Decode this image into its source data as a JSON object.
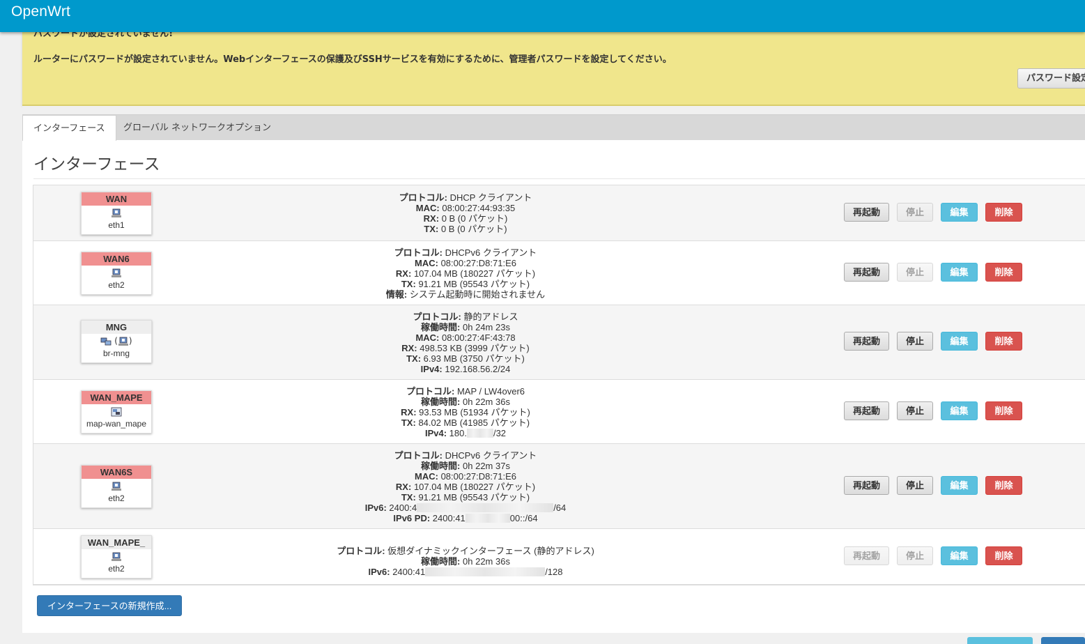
{
  "app": {
    "brand": "OpenWrt"
  },
  "alert": {
    "title": "パスワードが設定されていません!",
    "message": "ルーターにパスワードが設定されていません。Webインターフェースの保護及びSSHサービスを有効にするために、管理者パスワードを設定してください。",
    "button": "パスワード設定"
  },
  "tabs": [
    {
      "label": "インターフェース",
      "active": true
    },
    {
      "label": "グローバル ネットワークオプション",
      "active": false
    }
  ],
  "page_title": "インターフェース",
  "labels": {
    "protocol": "プロトコル:",
    "uptime": "稼働時間:",
    "mac": "MAC:",
    "rx": "RX:",
    "tx": "TX:",
    "info": "情報:",
    "ipv4": "IPv4:",
    "ipv6": "IPv6:",
    "ipv6pd": "IPv6 PD:"
  },
  "buttons": {
    "restart": "再起動",
    "stop": "停止",
    "edit": "編集",
    "delete": "削除",
    "add": "インターフェースの新規作成..."
  },
  "interfaces": [
    {
      "name": "WAN",
      "device": "eth1",
      "color": "#f09090",
      "protocol": "DHCP クライアント",
      "mac": "08:00:27:44:93:35",
      "rx": "0 B (0 パケット)",
      "tx": "0 B (0 パケット)"
    },
    {
      "name": "WAN6",
      "device": "eth2",
      "color": "#f09090",
      "protocol": "DHCPv6 クライアント",
      "mac": "08:00:27:D8:71:E6",
      "rx": "107.04 MB (180227 パケット)",
      "tx": "91.21 MB (95543 パケット)",
      "info": "システム起動時に開始されません"
    },
    {
      "name": "MNG",
      "device": "br-mng",
      "color": "#eeeeee",
      "protocol": "静的アドレス",
      "uptime": "0h 24m 23s",
      "mac": "08:00:27:4F:43:78",
      "rx": "498.53 KB (3999 パケット)",
      "tx": "6.93 MB (3750 パケット)",
      "ipv4": "192.168.56.2/24"
    },
    {
      "name": "WAN_MAPE",
      "device": "map-wan_mape",
      "color": "#f09090",
      "protocol": "MAP / LW4over6",
      "uptime": "0h 22m 36s",
      "rx": "93.53 MB (51934 パケット)",
      "tx": "84.02 MB (41985 パケット)",
      "ipv4_a": "180.",
      "ipv4_b": "/32"
    },
    {
      "name": "WAN6S",
      "device": "eth2",
      "color": "#f09090",
      "protocol": "DHCPv6 クライアント",
      "uptime": "0h 22m 37s",
      "mac": "08:00:27:D8:71:E6",
      "rx": "107.04 MB (180227 パケット)",
      "tx": "91.21 MB (95543 パケット)",
      "ipv6_a": "2400:4",
      "ipv6_b": "/64",
      "ipv6pd_a": "2400:41",
      "ipv6pd_b": "00::/64"
    },
    {
      "name": "WAN_MAPE_",
      "device": "eth2",
      "color": "#eeeeee",
      "protocol": "仮想ダイナミックインターフェース (静的アドレス)",
      "uptime": "0h 22m 36s",
      "ipv6_a": "2400:41",
      "ipv6_b": "/128"
    }
  ]
}
